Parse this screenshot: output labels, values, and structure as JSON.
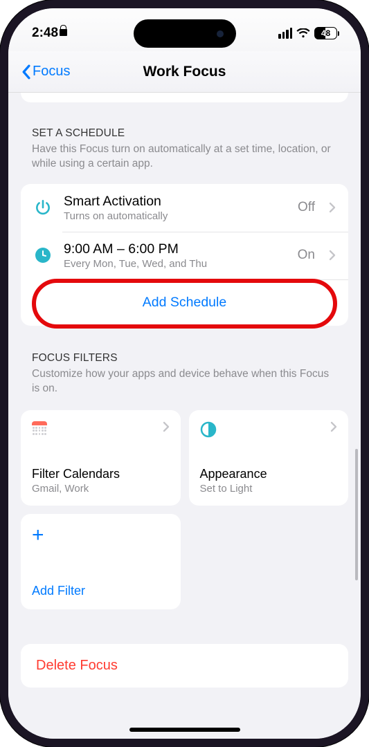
{
  "status": {
    "time": "2:48",
    "battery": "48"
  },
  "nav": {
    "back": "Focus",
    "title": "Work Focus"
  },
  "schedule": {
    "header": "SET A SCHEDULE",
    "desc": "Have this Focus turn on automatically at a set time, location, or while using a certain app.",
    "rows": [
      {
        "title": "Smart Activation",
        "sub": "Turns on automatically",
        "value": "Off"
      },
      {
        "title": "9:00 AM – 6:00 PM",
        "sub": "Every Mon, Tue, Wed, and Thu",
        "value": "On"
      }
    ],
    "add": "Add Schedule"
  },
  "filters": {
    "header": "FOCUS FILTERS",
    "desc": "Customize how your apps and device behave when this Focus is on.",
    "tiles": [
      {
        "title": "Filter Calendars",
        "sub": "Gmail, Work"
      },
      {
        "title": "Appearance",
        "sub": "Set to Light"
      }
    ],
    "add": "Add Filter"
  },
  "delete": "Delete Focus"
}
